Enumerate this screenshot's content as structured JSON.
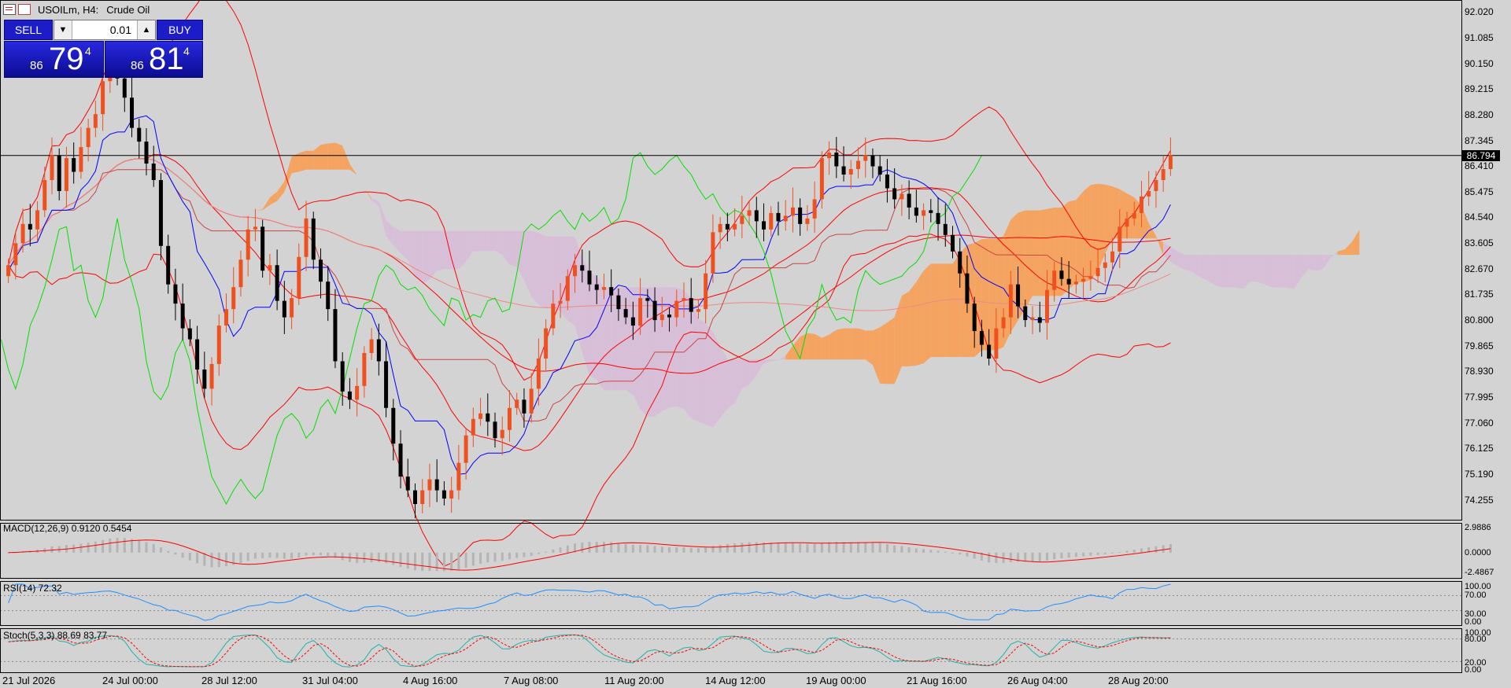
{
  "header": {
    "symbol": "USOILm, H4:",
    "name": "Crude Oil"
  },
  "trade_panel": {
    "sell_label": "SELL",
    "buy_label": "BUY",
    "lot_value": "0.01",
    "bid_small": "86",
    "bid_big": "79",
    "bid_sup": "4",
    "ask_small": "86",
    "ask_big": "81",
    "ask_sup": "4",
    "arrow_down": "▼",
    "arrow_up": "▲"
  },
  "price_axis": [
    "92.020",
    "91.085",
    "90.150",
    "89.215",
    "88.280",
    "87.345",
    "86.410",
    "85.475",
    "84.540",
    "83.605",
    "82.670",
    "81.735",
    "80.800",
    "79.865",
    "78.930",
    "77.995",
    "77.060",
    "76.125",
    "75.190",
    "74.255"
  ],
  "current_price": "86.794",
  "time_axis": [
    "21 Jul 2026",
    "24 Jul 00:00",
    "28 Jul 12:00",
    "31 Jul 04:00",
    "4 Aug 16:00",
    "7 Aug 08:00",
    "11 Aug 20:00",
    "14 Aug 12:00",
    "19 Aug 00:00",
    "21 Aug 16:00",
    "26 Aug 04:00",
    "28 Aug 20:00"
  ],
  "indicators": {
    "macd": {
      "title": "MACD(12,26,9) 0.9120 0.5454",
      "levels": [
        "2.9886",
        "0.0000",
        "-2.4867"
      ]
    },
    "rsi": {
      "title": "RSI(14) 72.32",
      "levels": [
        "100.00",
        "70.00",
        "30.00",
        "0.00"
      ]
    },
    "stoch": {
      "title": "Stoch(5,3,3) 88.69 83.77",
      "levels": [
        "100.00",
        "80.00",
        "20.00",
        "0.00"
      ]
    }
  },
  "colors": {
    "background": "#d3d3d3",
    "bull": "#f0501e",
    "bear": "#000000",
    "cloud_bull": "#f4a460",
    "cloud_bear": "#d8bfd8",
    "tenkan": "#0000ff",
    "chikou": "#00e000",
    "bands": "#ff0000",
    "rsi_line": "#1e90ff",
    "stoch_main": "#20b2aa",
    "stoch_signal": "#ff0000",
    "macd_hist": "#b4b4b4",
    "macd_signal": "#ff0000"
  },
  "chart_data": {
    "type": "candlestick",
    "title": "USOILm, H4: Crude Oil",
    "ylim": [
      73.5,
      92.4
    ],
    "y_ticks": [
      92.02,
      91.085,
      90.15,
      89.215,
      88.28,
      87.345,
      86.41,
      85.475,
      84.54,
      83.605,
      82.67,
      81.735,
      80.8,
      79.865,
      78.93,
      77.995,
      77.06,
      76.125,
      75.19,
      74.255
    ],
    "current": 86.794,
    "closes": [
      82.8,
      83.6,
      84.3,
      84.1,
      84.8,
      85.9,
      86.8,
      85.5,
      86.7,
      86.2,
      87.1,
      87.8,
      88.3,
      89.5,
      90.0,
      89.6,
      88.9,
      87.8,
      87.3,
      86.5,
      85.9,
      83.5,
      82.1,
      81.4,
      80.5,
      80.1,
      79.0,
      78.3,
      79.2,
      80.6,
      81.2,
      82.0,
      83.0,
      84.1,
      84.2,
      82.6,
      82.8,
      81.5,
      80.9,
      81.6,
      83.1,
      84.5,
      83.0,
      82.2,
      81.2,
      79.3,
      78.2,
      77.9,
      78.4,
      79.6,
      80.1,
      79.3,
      77.6,
      76.3,
      75.1,
      74.6,
      74.1,
      74.6,
      75.0,
      74.6,
      74.3,
      74.6,
      75.6,
      76.6,
      77.2,
      77.4,
      77.1,
      76.5,
      76.8,
      77.6,
      77.9,
      77.4,
      78.3,
      79.4,
      80.5,
      81.4,
      81.5,
      82.4,
      82.8,
      82.6,
      82.1,
      81.9,
      82.0,
      81.7,
      81.2,
      80.9,
      80.6,
      81.6,
      81.5,
      80.8,
      81.0,
      80.9,
      81.5,
      81.6,
      81.1,
      81.2,
      82.5,
      84.0,
      84.3,
      84.1,
      84.3,
      84.6,
      84.8,
      84.4,
      84.1,
      84.7,
      84.4,
      84.6,
      84.9,
      84.3,
      84.5,
      85.2,
      86.7,
      86.9,
      86.4,
      86.1,
      86.3,
      86.6,
      86.8,
      86.4,
      86.1,
      85.6,
      85.2,
      85.4,
      84.9,
      84.6,
      84.8,
      84.7,
      84.3,
      83.9,
      83.3,
      82.5,
      81.4,
      80.4,
      79.9,
      79.4,
      80.5,
      80.9,
      82.1,
      81.3,
      80.8,
      80.9,
      80.7,
      81.9,
      82.6,
      82.3,
      82.1,
      82.2,
      82.3,
      82.4,
      82.7,
      82.9,
      83.3,
      84.2,
      84.5,
      84.7,
      85.3,
      85.5,
      85.9,
      86.3,
      86.8
    ],
    "macd_range": [
      -2.4867,
      2.9886
    ],
    "rsi_last": 72.32,
    "stoch": {
      "main": 88.69,
      "signal": 83.77
    }
  }
}
